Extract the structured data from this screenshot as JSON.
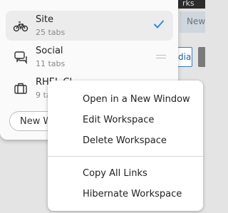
{
  "background": {
    "top_fragment": "rks",
    "new_fragment": "New",
    "dia_fragment": "dia"
  },
  "workspaces": [
    {
      "name": "Site",
      "count": "25 tabs",
      "icon": "bicycle-icon",
      "active": true
    },
    {
      "name": "Social",
      "count": "11 tabs",
      "icon": "chat-icon",
      "active": false
    },
    {
      "name": "RHEL Cl",
      "count": "9 ta",
      "icon": "briefcase-icon",
      "active": false
    }
  ],
  "new_workspace_label": "New W",
  "context_menu": {
    "items": [
      "Open in a New Window",
      "Edit Workspace",
      "Delete Workspace",
      "Copy All Links",
      "Hibernate Workspace"
    ]
  },
  "colors": {
    "accent": "#3584e4"
  }
}
